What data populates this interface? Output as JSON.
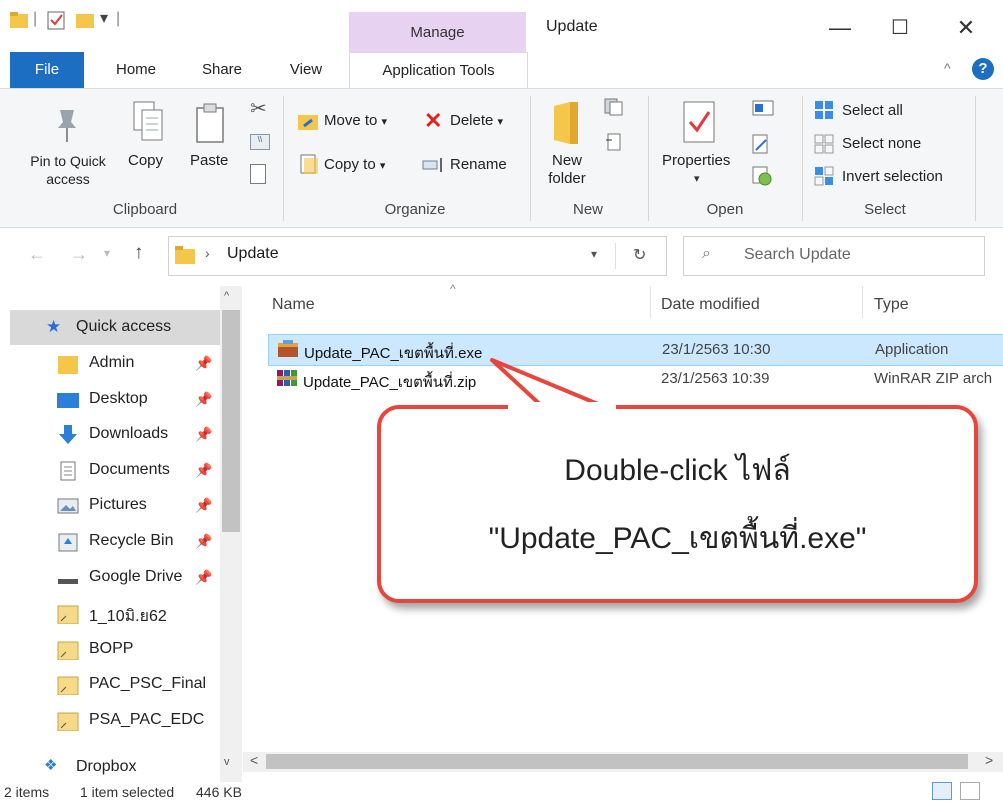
{
  "window": {
    "title": "Update",
    "manage_tab": "Manage",
    "minimize": "—",
    "maximize": "☐",
    "close": "✕"
  },
  "tabs": {
    "file": "File",
    "home": "Home",
    "share": "Share",
    "view": "View",
    "app_tools": "Application Tools"
  },
  "ribbon": {
    "clipboard": {
      "pin_line1": "Pin to Quick",
      "pin_line2": "access",
      "copy": "Copy",
      "paste": "Paste",
      "group": "Clipboard"
    },
    "organize": {
      "move_to": "Move to",
      "copy_to": "Copy to",
      "delete": "Delete",
      "rename": "Rename",
      "group": "Organize"
    },
    "new": {
      "new_line1": "New",
      "new_line2": "folder",
      "group": "New"
    },
    "open": {
      "properties": "Properties",
      "group": "Open"
    },
    "select": {
      "select_all": "Select all",
      "select_none": "Select none",
      "invert": "Invert selection",
      "group": "Select"
    }
  },
  "address": {
    "path": "Update",
    "search_placeholder": "Search Update"
  },
  "nav": {
    "quick_access": "Quick access",
    "items": [
      {
        "label": "Admin"
      },
      {
        "label": "Desktop"
      },
      {
        "label": "Downloads"
      },
      {
        "label": "Documents"
      },
      {
        "label": "Pictures"
      },
      {
        "label": "Recycle Bin"
      },
      {
        "label": "Google Drive"
      },
      {
        "label": "1_10มิ.ย62"
      },
      {
        "label": "BOPP"
      },
      {
        "label": "PAC_PSC_Final"
      },
      {
        "label": "PSA_PAC_EDC"
      }
    ],
    "dropbox": "Dropbox"
  },
  "columns": {
    "name": "Name",
    "date": "Date modified",
    "type": "Type"
  },
  "files": [
    {
      "name": "Update_PAC_เขตพื้นที่.exe",
      "date": "23/1/2563 10:30",
      "type": "Application"
    },
    {
      "name": "Update_PAC_เขตพื้นที่.zip",
      "date": "23/1/2563 10:39",
      "type": "WinRAR ZIP arch"
    }
  ],
  "callout": {
    "line1": "Double-click ไฟล์",
    "line2": "\"Update_PAC_เขตพื้นที่.exe\""
  },
  "status": {
    "items": "2 items",
    "selected": "1 item selected",
    "size": "446 KB"
  }
}
